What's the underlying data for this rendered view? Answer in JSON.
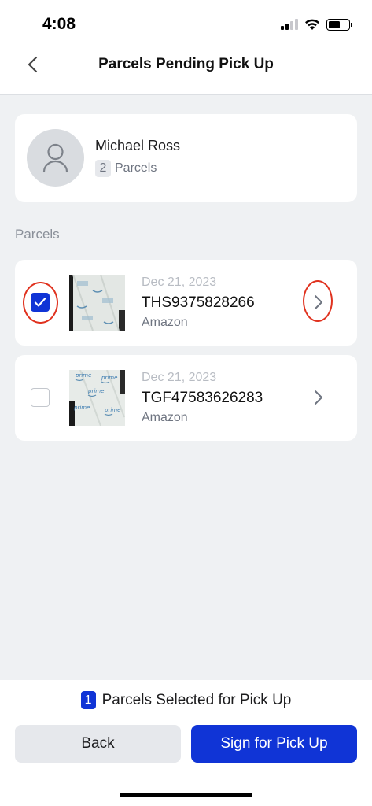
{
  "status_bar": {
    "time": "4:08"
  },
  "header": {
    "title": "Parcels Pending Pick Up",
    "back_icon": "chevron-left-icon"
  },
  "customer": {
    "name": "Michael Ross",
    "parcel_count": "2",
    "parcel_label": "Parcels",
    "avatar_icon": "person-icon"
  },
  "parcels_section": {
    "label": "Parcels"
  },
  "parcels": [
    {
      "date": "Dec 21, 2023",
      "tracking": "THS9375828266",
      "carrier": "Amazon",
      "selected": true,
      "thumb_icon": "package-photo",
      "print": "prime"
    },
    {
      "date": "Dec 21, 2023",
      "tracking": "TGF47583626283",
      "carrier": "Amazon",
      "selected": false,
      "thumb_icon": "package-photo",
      "print": "prime"
    }
  ],
  "footer": {
    "selected_count": "1",
    "selected_label": "Parcels Selected for Pick Up",
    "back_label": "Back",
    "sign_label": "Sign for Pick Up"
  },
  "colors": {
    "accent": "#1034d6",
    "highlight": "#e0321f",
    "background": "#eff1f3"
  }
}
